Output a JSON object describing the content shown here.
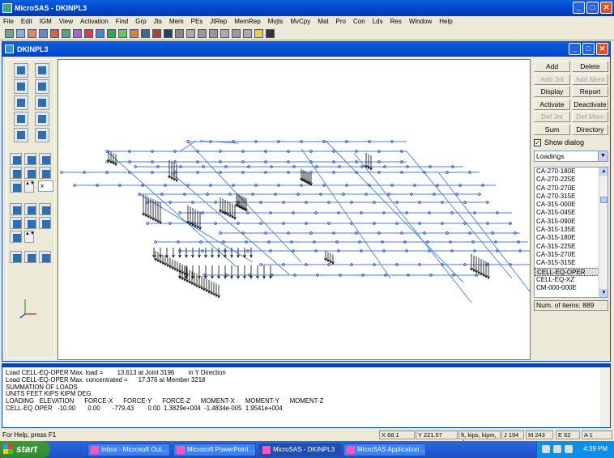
{
  "app": {
    "title": "MicroSAS - DKINPL3"
  },
  "menu": [
    "File",
    "Edit",
    "IGM",
    "View",
    "Activation",
    "Find",
    "Grp",
    "Jts",
    "Mem",
    "PEs",
    "JtRep",
    "MemRep",
    "Mvjts",
    "MvCpy",
    "Mat",
    "Pro",
    "Con",
    "Lds",
    "Res",
    "Window",
    "Help"
  ],
  "child": {
    "title": "DKINPL3"
  },
  "rightpanel": {
    "buttons": [
      {
        "label": "Add",
        "enabled": true
      },
      {
        "label": "Delete",
        "enabled": true
      },
      {
        "label": "Add Jnt",
        "enabled": false
      },
      {
        "label": "Add Mem",
        "enabled": false
      },
      {
        "label": "Display",
        "enabled": true
      },
      {
        "label": "Report",
        "enabled": true
      },
      {
        "label": "Activate",
        "enabled": true
      },
      {
        "label": "Deactivate",
        "enabled": true
      },
      {
        "label": "Def Jnt",
        "enabled": false
      },
      {
        "label": "Def Mem",
        "enabled": false
      },
      {
        "label": "Sum",
        "enabled": true
      },
      {
        "label": "Directory",
        "enabled": true
      }
    ],
    "show_dialog": "Show dialog",
    "combo_value": "Loadings",
    "list": [
      "CA-270-180E",
      "CA-270-225E",
      "CA-270-270E",
      "CA-270-315E",
      "CA-315-000E",
      "CA-315-045E",
      "CA-315-090E",
      "CA-315-135E",
      "CA-315-180E",
      "CA-315-225E",
      "CA-315-270E",
      "CA-315-315E",
      "CELL-EQ-OPER",
      "CELL-EQ-XZ",
      "CM-000-000E"
    ],
    "selected": "CELL-EQ-OPER",
    "num_items": "Num. of items: 889"
  },
  "palette": {
    "dropdown_value": "x"
  },
  "output": {
    "lines": [
      "Load CELL-EQ-OPER Max. load =        13.613 at Joint 3196        in Y Direction",
      "Load CELL-EQ-OPER Max. concentrated =      17.376 at Member 3218",
      "SUMMATION OF LOADS",
      "UNITS FEET KIPS KIPM DEG",
      "LOADING   ELEVATION      FORCE-X      FORCE-Y      FORCE-Z      MOMENT-X      MOMENT-Y      MOMENT-Z",
      "CELL-EQ OPER   -10.00       0.00       -779.43        0.00  1.3829e+004  -1.4834e-005  1.9541e+004"
    ]
  },
  "status": {
    "ready": "For Help, press F1",
    "cells": [
      "X 68.1",
      "Y 221.57",
      "ft, kips, kipm, deg",
      "J 194",
      "M 243",
      "E 62",
      "A 1"
    ]
  },
  "taskbar": {
    "start": "start",
    "tasks": [
      "Inbox - Microsoft Out...",
      "Microsoft PowerPoint ...",
      "MicroSAS - DKINPL3",
      "MicroSAS Application ..."
    ],
    "active_task": "MicroSAS - DKINPL3",
    "clock": "4:39 PM"
  },
  "colors": {
    "member": "#4A7FD8",
    "joint": "#2040B0",
    "load": "#000000",
    "titlebar": "#0044C8"
  }
}
